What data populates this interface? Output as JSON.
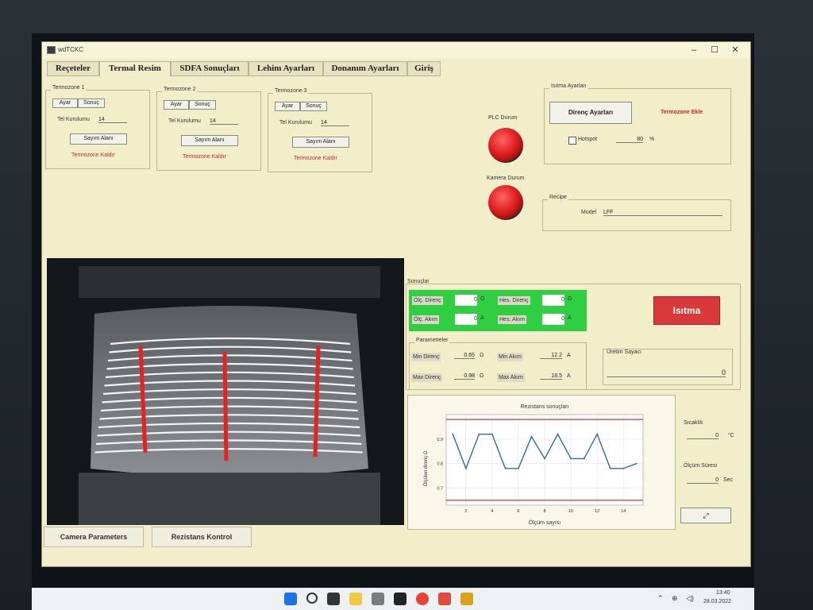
{
  "window": {
    "title": "wdTCKC"
  },
  "tabs": [
    {
      "label": "Reçeteler"
    },
    {
      "label": "Termal Resim"
    },
    {
      "label": "SDFA Sonuçları"
    },
    {
      "label": "Lehim Ayarları"
    },
    {
      "label": "Donanım Ayarları"
    },
    {
      "label": "Giriş"
    }
  ],
  "zones": [
    {
      "title": "Termozone 1",
      "tab_ayar": "Ayar",
      "tab_sonuc": "Sonuç",
      "tel_label": "Tel Kurulumu",
      "tel_value": "14",
      "sayim_button": "Sayım Alanı",
      "kaldir_link": "Termozone Kaldır"
    },
    {
      "title": "Termozone 2",
      "tab_ayar": "Ayar",
      "tab_sonuc": "Sonuç",
      "tel_label": "Tel Kurulumu",
      "tel_value": "14",
      "sayim_button": "Sayım Alanı",
      "kaldir_link": "Termozone Kaldır"
    },
    {
      "title": "Termozone 3",
      "tab_ayar": "Ayar",
      "tab_sonuc": "Sonuç",
      "tel_label": "Tel Kurulumu",
      "tel_value": "14",
      "sayim_button": "Sayım Alanı",
      "kaldir_link": "Termozone Kaldır"
    }
  ],
  "status": {
    "plc_label": "PLC Durum",
    "camera_label": "Kamera Durum",
    "lamp_color": "#e02020"
  },
  "isitma": {
    "title": "Isıtma Ayarları",
    "direnc_button": "Direnç Ayarları",
    "ekle_link": "Termozone Ekle",
    "hotspot_label": "Hotspot",
    "hotspot_value": "80",
    "percent": "%"
  },
  "recipe": {
    "title": "Recipe",
    "model_label": "Model",
    "model_value": "LFF"
  },
  "sonuclar": {
    "title": "Sonuçlar",
    "olc_direnc_label": "Ölç. Direnç",
    "olc_direnc_value": "0",
    "ohm": "Ω",
    "hes_direnc_label": "Hes. Direnç",
    "hes_direnc_value": "0",
    "olc_akim_label": "Ölç. Akım",
    "olc_akim_value": "0",
    "amp": "A",
    "hes_akim_label": "Hes. Akım",
    "hes_akim_value": "0",
    "isitma_button": "Isıtma"
  },
  "parametreler": {
    "title": "Parametreler",
    "min_direnc_label": "Min Direnç",
    "min_direnc_value": "0.65",
    "max_direnc_label": "Max Direnç",
    "max_direnc_value": "0.98",
    "min_akim_label": "Min Akım",
    "min_akim_value": "12.2",
    "max_akim_label": "Max Akım",
    "max_akim_value": "18.5",
    "ohm": "Ω",
    "amp": "A"
  },
  "uretim": {
    "title": "Üretim Sayacı",
    "value": "0"
  },
  "side": {
    "sicaklik_label": "Sıcaklık",
    "sicaklik_value": "0",
    "sicaklik_unit": "°C",
    "olcum_label": "Ölçüm Süresi",
    "olcum_value": "0",
    "olcum_unit": "Sec"
  },
  "bottom": {
    "camera_params": "Camera Parameters",
    "rezistans_kontrol": "Rezistans Kontrol"
  },
  "taskbar": {
    "time": "13:40",
    "date": "28.03.2022"
  },
  "chart_data": {
    "type": "line",
    "title": "Rezistans sonuçları",
    "xlabel": "Ölçüm sayısı",
    "ylabel": "Ölçülen direnç Ω",
    "x": [
      1,
      2,
      3,
      4,
      5,
      6,
      7,
      8,
      9,
      10,
      11,
      12,
      13,
      14,
      15
    ],
    "series": [
      {
        "values": [
          0.92,
          0.78,
          0.92,
          0.92,
          0.78,
          0.78,
          0.91,
          0.82,
          0.92,
          0.82,
          0.82,
          0.92,
          0.78,
          0.78,
          0.8
        ]
      }
    ],
    "limits": [
      0.98,
      0.65
    ],
    "xticks": [
      2,
      4,
      6,
      8,
      10,
      12,
      14
    ],
    "yticks": [
      0.7,
      0.8,
      0.9
    ],
    "xlim": [
      0.5,
      15.5
    ],
    "ylim": [
      0.63,
      1.0
    ],
    "line_color": "#2f6f9a",
    "limit_color": "#e03030",
    "grid": true
  }
}
